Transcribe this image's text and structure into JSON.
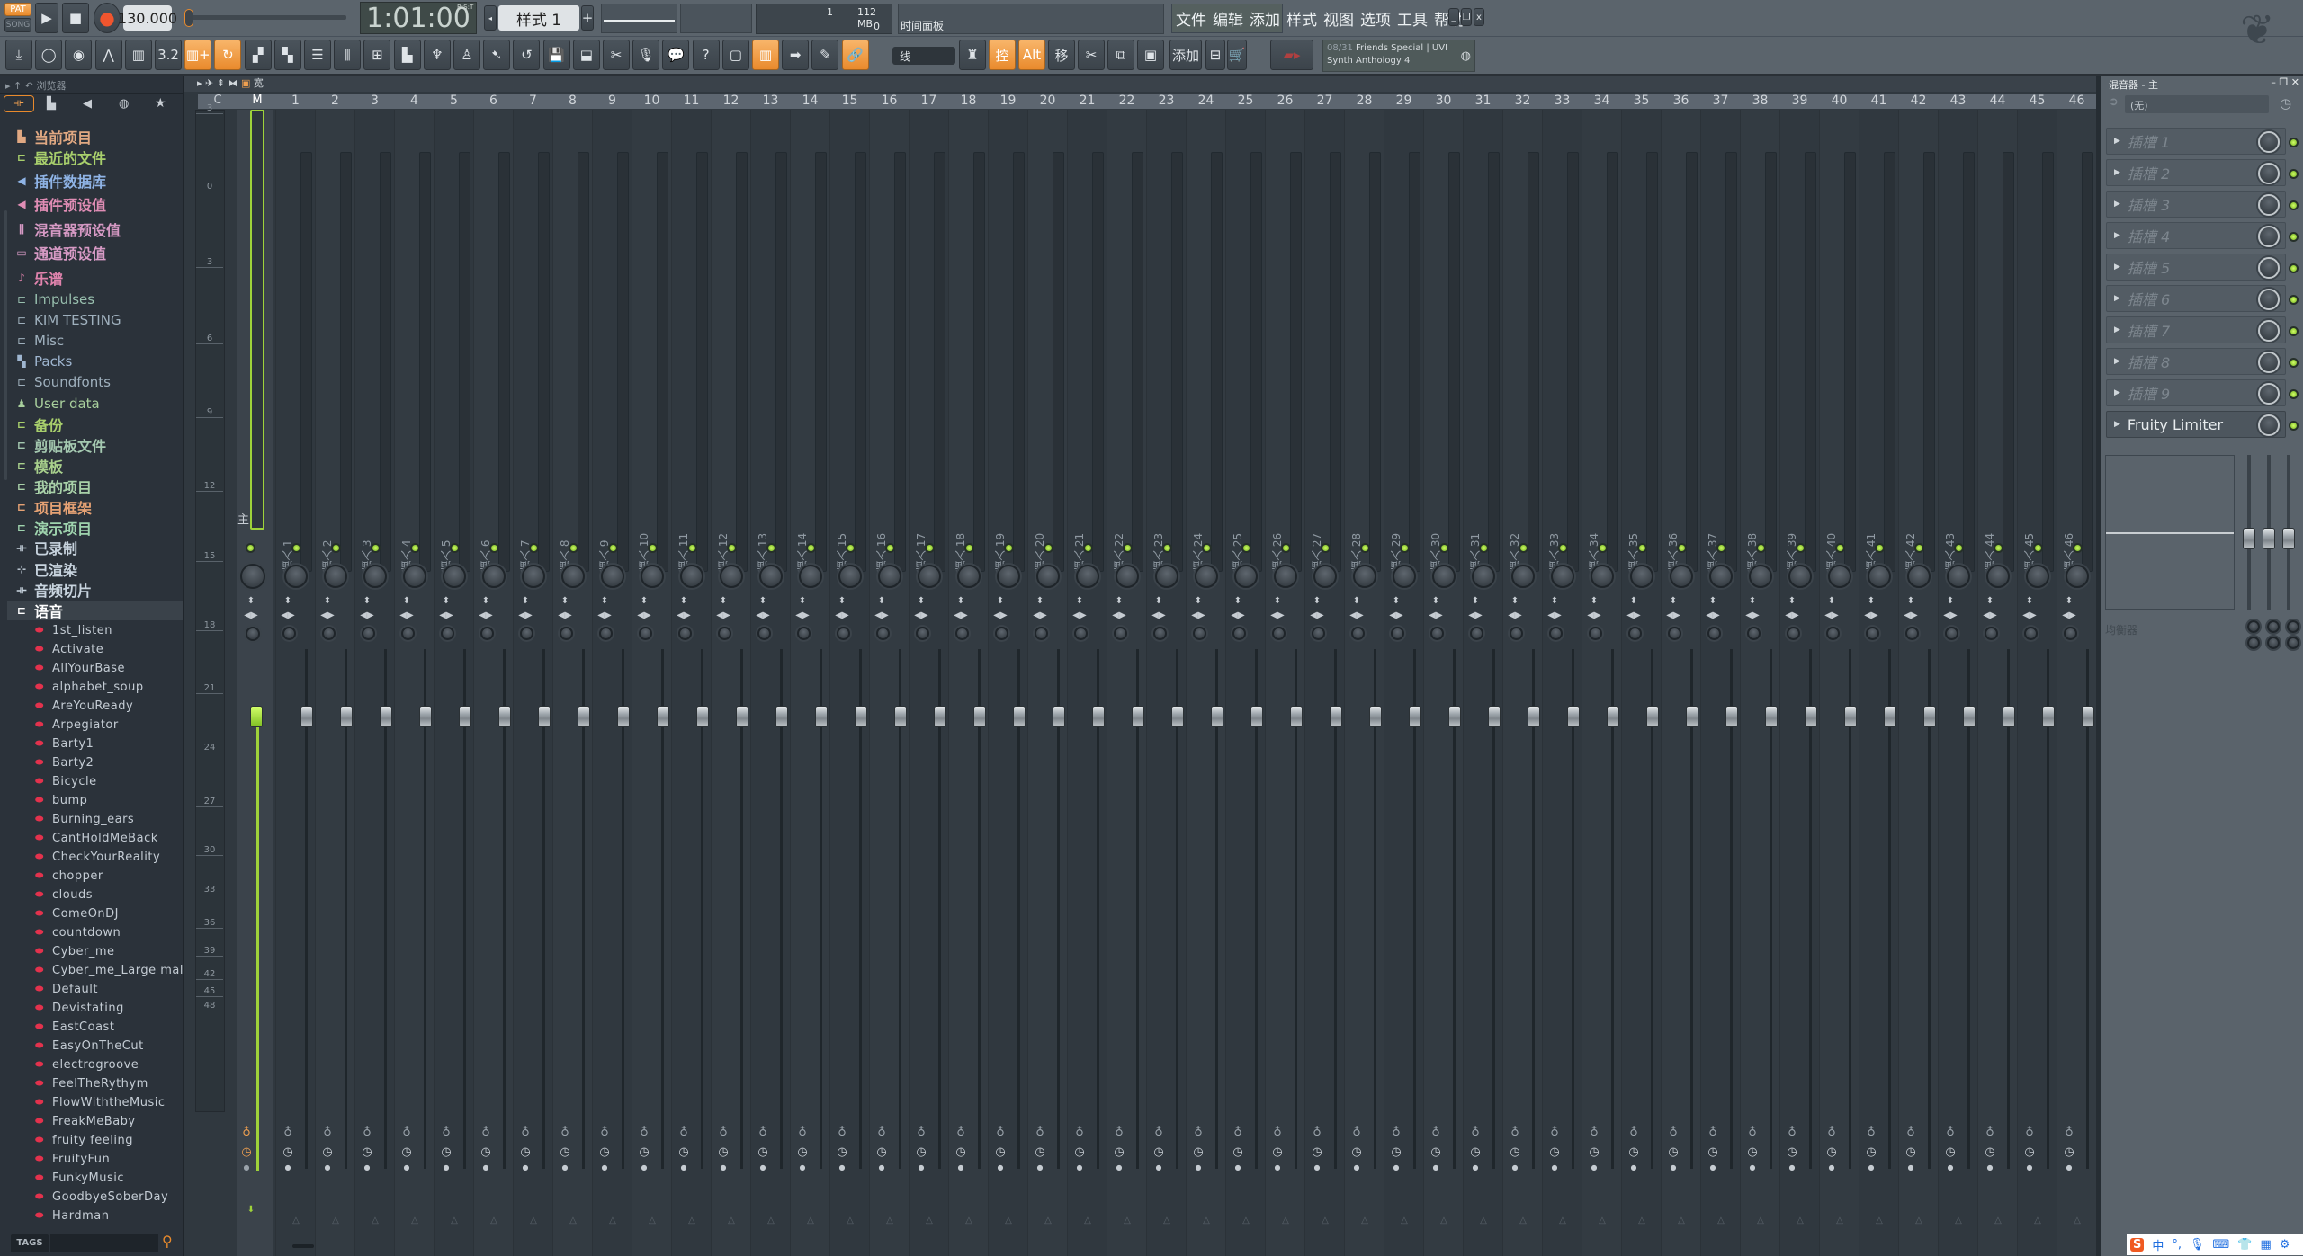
{
  "transport": {
    "pat": "PAT",
    "song": "SONG",
    "tempo": "130.000",
    "time": "1:01:00",
    "time_format": "B:S:T",
    "pattern": "样式 1",
    "cpu": "1",
    "memory": "112 MB",
    "polyphony": "0",
    "hint_title": "时间面板"
  },
  "menu": [
    "文件",
    "编辑",
    "添加",
    "样式",
    "视图",
    "选项",
    "工具",
    "帮助"
  ],
  "toolbar": {
    "snap": "线",
    "ctrl_label": "控",
    "alt_label": "Alt",
    "move_label": "移",
    "add_label": "添加",
    "news_date": "08/31",
    "news_title": "Friends Special | UVI",
    "news_sub": "Synth Anthology 4"
  },
  "browser": {
    "title": "浏览器",
    "tags_label": "TAGS",
    "items": [
      {
        "label": "当前项目",
        "icon": "project-icon",
        "color": "#e0a882",
        "big": true
      },
      {
        "label": "最近的文件",
        "icon": "recent-folder-icon",
        "color": "#a8cf6c",
        "big": true
      },
      {
        "label": "插件数据库",
        "icon": "plugin-db-icon",
        "color": "#8fb4e6",
        "big": true
      },
      {
        "label": "插件预设值",
        "icon": "plugin-preset-icon",
        "color": "#e08db5",
        "big": true
      },
      {
        "label": "混音器预设值",
        "icon": "mixer-preset-icon",
        "color": "#d79ac5",
        "big": true
      },
      {
        "label": "通道预设值",
        "icon": "channel-preset-icon",
        "color": "#d79ac5",
        "big": true
      },
      {
        "label": "乐谱",
        "icon": "note-icon",
        "color": "#e083ad",
        "big": true
      },
      {
        "label": "Impulses",
        "icon": "folder-icon",
        "color": "#98bfae"
      },
      {
        "label": "KIM TESTING",
        "icon": "folder-icon",
        "color": "#9fb0bd"
      },
      {
        "label": "Misc",
        "icon": "folder-icon",
        "color": "#9fb0bd"
      },
      {
        "label": "Packs",
        "icon": "packs-icon",
        "color": "#9fb6d0"
      },
      {
        "label": "Soundfonts",
        "icon": "folder-icon",
        "color": "#9fb0bd"
      },
      {
        "label": "User data",
        "icon": "user-icon",
        "color": "#a8cf9c"
      },
      {
        "label": "备份",
        "icon": "backup-folder-icon",
        "color": "#a8cf6c",
        "big": true
      },
      {
        "label": "剪贴板文件",
        "icon": "folder-icon",
        "color": "#a4c8b0",
        "big": true
      },
      {
        "label": "模板",
        "icon": "folder-icon",
        "color": "#a8d08c",
        "big": true
      },
      {
        "label": "我的项目",
        "icon": "folder-icon",
        "color": "#a8d0a8",
        "big": true
      },
      {
        "label": "项目框架",
        "icon": "folder-icon",
        "color": "#e6a274",
        "big": true
      },
      {
        "label": "演示项目",
        "icon": "folder-icon",
        "color": "#9fd4ae",
        "big": true
      },
      {
        "label": "已录制",
        "icon": "waveform-icon",
        "color": "#c7d3de",
        "big": true
      },
      {
        "label": "已渲染",
        "icon": "rendered-icon",
        "color": "#c7d3de",
        "big": true
      },
      {
        "label": "音频切片",
        "icon": "waveform-icon",
        "color": "#c7d3de",
        "big": true
      },
      {
        "label": "语音",
        "icon": "folder-icon",
        "color": "#ffffff",
        "big": true,
        "selected": true
      }
    ],
    "voices": [
      "1st_listen",
      "Activate",
      "AllYourBase",
      "alphabet_soup",
      "AreYouReady",
      "Arpegiator",
      "Barty1",
      "Barty2",
      "Bicycle",
      "bump",
      "Burning_ears",
      "CantHoldMeBack",
      "CheckYourReality",
      "chopper",
      "clouds",
      "ComeOnDJ",
      "countdown",
      "Cyber_me",
      "Cyber_me_Large male",
      "Default",
      "Devistating",
      "EastCoast",
      "EasyOnTheCut",
      "electrogroove",
      "FeelTheRythym",
      "FlowWiththeMusic",
      "FreakMeBaby",
      "fruity feeling",
      "FruityFun",
      "FunkyMusic",
      "GoodbyeSoberDay",
      "Hardman"
    ]
  },
  "mixer": {
    "toolbar_label": "宽",
    "current_label": "C",
    "master_label": "M",
    "master_sub": "主",
    "scale": [
      "3",
      "0",
      "3",
      "6",
      "9",
      "12",
      "15",
      "18",
      "21",
      "24",
      "27",
      "30",
      "33",
      "36",
      "39",
      "42",
      "45",
      "48"
    ],
    "tracks": [
      "插入 1",
      "插入 2",
      "插入 3",
      "插入 4",
      "插入 5",
      "插入 6",
      "插入 7",
      "插入 8",
      "插入 9",
      "插入 10",
      "插入 11",
      "插入 12",
      "插入 13",
      "插入 14",
      "插入 15",
      "插入 16",
      "插入 17",
      "插入 18",
      "插入 19",
      "插入 20",
      "插入 21",
      "插入 22",
      "插入 23",
      "插入 24",
      "插入 25",
      "插入 26",
      "插入 27",
      "插入 28",
      "插入 29",
      "插入 30",
      "插入 31",
      "插入 32",
      "插入 33",
      "插入 34",
      "插入 35",
      "插入 36",
      "插入 37",
      "插入 38",
      "插入 39",
      "插入 40",
      "插入 41",
      "插入 42",
      "插入 43",
      "插入 44",
      "插入 45",
      "插入 46"
    ],
    "accent": "#9ed23a"
  },
  "panel": {
    "title": "混音器 - 主",
    "input": "(无)",
    "slots": [
      "插槽 1",
      "插槽 2",
      "插槽 3",
      "插槽 4",
      "插槽 5",
      "插槽 6",
      "插槽 7",
      "插槽 8",
      "插槽 9",
      "Fruity Limiter"
    ],
    "eq_label": "均衡器"
  },
  "ime": {
    "lang": "中"
  }
}
